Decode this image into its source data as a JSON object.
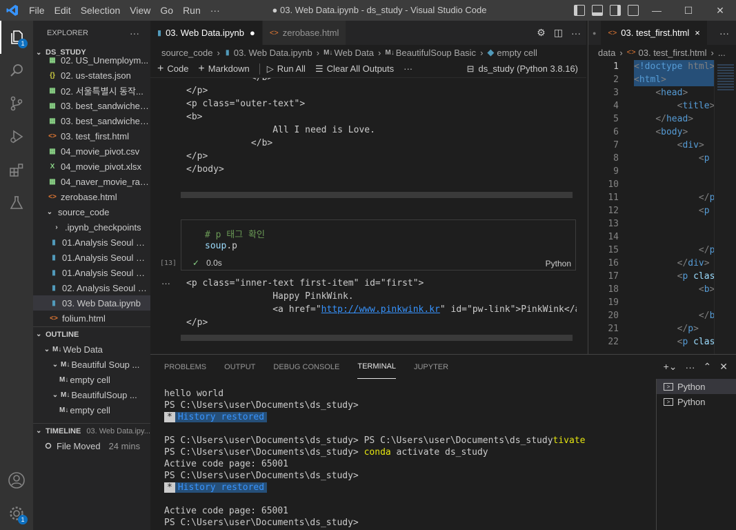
{
  "titlebar": {
    "menu": [
      "File",
      "Edit",
      "Selection",
      "View",
      "Go",
      "Run",
      "···"
    ],
    "title": "● 03. Web Data.ipynb - ds_study - Visual Studio Code"
  },
  "activity": {
    "explorer_badge": "1",
    "settings_badge": "1"
  },
  "sidebar": {
    "header": "EXPLORER",
    "root": "DS_STUDY",
    "files": [
      {
        "name": "02. US_Unemploym...",
        "type": "csv"
      },
      {
        "name": "02. us-states.json",
        "type": "json"
      },
      {
        "name": "02. 서울특별시 동작...",
        "type": "csv"
      },
      {
        "name": "03. best_sandwiches...",
        "type": "csv"
      },
      {
        "name": "03. best_sandwiches...",
        "type": "csv"
      },
      {
        "name": "03. test_first.html",
        "type": "html"
      },
      {
        "name": "04_movie_pivot.csv",
        "type": "csv"
      },
      {
        "name": "04_movie_pivot.xlsx",
        "type": "xlsx"
      },
      {
        "name": "04_naver_movie_raw...",
        "type": "csv"
      },
      {
        "name": "zerobase.html",
        "type": "html"
      }
    ],
    "folder": "source_code",
    "source_files": [
      {
        "name": ".ipynb_checkpoints",
        "type": "folder"
      },
      {
        "name": "01.Analysis Seoul CC...",
        "type": "nb"
      },
      {
        "name": "01.Analysis Seoul CC...",
        "type": "nb"
      },
      {
        "name": "01.Analysis Seoul CC...",
        "type": "nb"
      },
      {
        "name": "02. Analysis Seoul Cr...",
        "type": "nb"
      },
      {
        "name": "03. Web Data.ipynb",
        "type": "nb"
      },
      {
        "name": "folium.html",
        "type": "html"
      }
    ],
    "outline_header": "OUTLINE",
    "outline": [
      {
        "label": "Web Data",
        "level": 0
      },
      {
        "label": "Beautiful Soup ...",
        "level": 1
      },
      {
        "label": "empty cell",
        "level": 2
      },
      {
        "label": "BeautifulSoup ...",
        "level": 1
      },
      {
        "label": "empty cell",
        "level": 2
      }
    ],
    "timeline_header": "TIMELINE",
    "timeline_file": "03. Web Data.ipy...",
    "timeline_item": "File Moved",
    "timeline_time": "24 mins"
  },
  "editor1": {
    "tabs": [
      {
        "label": "03. Web Data.ipynb",
        "dirty": "●"
      },
      {
        "label": "zerobase.html",
        "close": "×"
      }
    ],
    "breadcrumb": [
      "source_code",
      "03. Web Data.ipynb",
      "Web Data",
      "BeautifulSoup Basic",
      "empty cell"
    ],
    "toolbar": {
      "code": "Code",
      "markdown": "Markdown",
      "run_all": "Run All",
      "clear": "Clear All Outputs",
      "more": "···",
      "kernel": "ds_study (Python 3.8.16)"
    },
    "output_top": [
      "            </b>",
      "</p>",
      "<p class=\"outer-text\">",
      "<b>",
      "                All I need is Love.",
      "            </b>",
      "</p>",
      "</body>"
    ],
    "cell": {
      "comment": "# p 태그 확인",
      "code_obj": "soup",
      "code_attr": ".p",
      "exec": "[13]",
      "time": "0.0s",
      "lang": "Python"
    },
    "output_bottom": {
      "line1": "<p class=\"inner-text first-item\" id=\"first\">",
      "line2": "                Happy PinkWink.",
      "line3_pre": "                <a href=\"",
      "line3_link": "http://www.pinkwink.kr",
      "line3_post": "\" id=\"pw-link\">PinkWink</a>",
      "line4": "</p>"
    }
  },
  "editor2": {
    "tab": "03. test_first.html",
    "close": "×",
    "breadcrumb": [
      "data",
      "03. test_first.html",
      "..."
    ],
    "lines": [
      "<!doctype html>",
      "<html>",
      "    <head>",
      "        <title>",
      "    </head>",
      "    <body>",
      "        <div>",
      "            <p",
      "",
      "",
      "            </p",
      "            <p",
      "",
      "",
      "            </p",
      "        </div>",
      "        <p clas",
      "            <b>",
      "",
      "            </b",
      "        </p>",
      "        <p clas"
    ]
  },
  "panel": {
    "tabs": [
      "PROBLEMS",
      "OUTPUT",
      "DEBUG CONSOLE",
      "TERMINAL",
      "JUPYTER"
    ],
    "terminals": [
      "Python",
      "Python"
    ],
    "lines": [
      {
        "text": "hello world"
      },
      {
        "text": "PS C:\\Users\\user\\Documents\\ds_study>"
      },
      {
        "hist": "History restored"
      },
      {
        "text": ""
      },
      {
        "text": "PS C:\\Users\\user\\Documents\\ds_study> PS C:\\Users\\user\\Documents\\ds_study",
        "yellow": "tivate"
      },
      {
        "text": "PS C:\\Users\\user\\Documents\\ds_study> ",
        "yellow": "conda",
        "rest": " activate ds_study"
      },
      {
        "text": "Active code page: 65001"
      },
      {
        "text": "PS C:\\Users\\user\\Documents\\ds_study>"
      },
      {
        "hist": "History restored"
      },
      {
        "text": ""
      },
      {
        "text": "Active code page: 65001"
      },
      {
        "text": "PS C:\\Users\\user\\Documents\\ds_study>"
      }
    ]
  }
}
